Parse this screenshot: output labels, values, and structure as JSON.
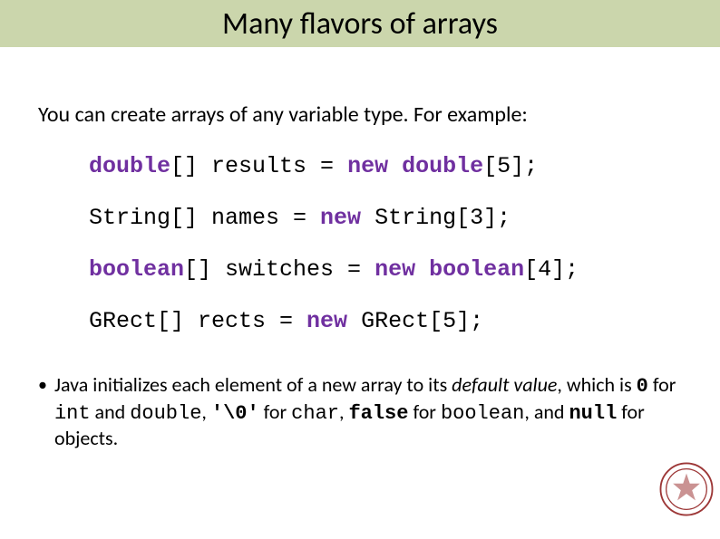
{
  "title": "Many flavors of arrays",
  "intro": "You can create arrays of any variable type.  For example:",
  "code": {
    "line1": {
      "type": "double",
      "rest": "[] results = ",
      "kw": "new ",
      "alloc": "double",
      "tail": "[5];"
    },
    "line2": {
      "pre": "String[] names = ",
      "kw": "new",
      "post": " String[3];"
    },
    "line3": {
      "type": "boolean",
      "rest": "[] switches = ",
      "kw": "new ",
      "alloc": "boolean",
      "tail": "[4];"
    },
    "line4": {
      "pre": "GRect[] rects = ",
      "kw": "new",
      "post": " GRect[5];"
    }
  },
  "bullet": {
    "b1": "Java initializes each element of a new array to its ",
    "b2": "default value",
    "b3": ", which is ",
    "v0": "0",
    "b4": " for ",
    "tint": "int",
    "b5": " and  ",
    "tdouble": "double",
    "b6": ", ",
    "vchar": "'\\0'",
    "b7": " for ",
    "tchar": "char",
    "b8": ", ",
    "vfalse": "false",
    "b9": " for ",
    "tbool": "boolean",
    "b10": ", and ",
    "vnull": "null",
    "b11": " for objects."
  }
}
